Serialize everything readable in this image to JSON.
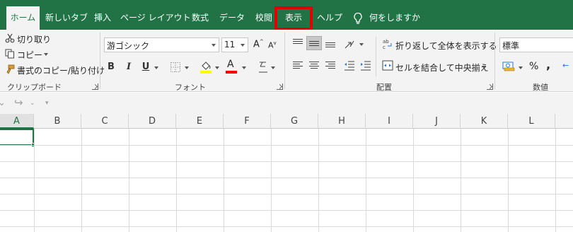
{
  "tabs": [
    {
      "label": "ホーム",
      "active": true
    },
    {
      "label": "新しいタブ"
    },
    {
      "label": "挿入"
    },
    {
      "label": "ページ レイアウト"
    },
    {
      "label": "数式"
    },
    {
      "label": "データ"
    },
    {
      "label": "校閲"
    },
    {
      "label": "表示",
      "highlighted": true
    },
    {
      "label": "ヘルプ"
    }
  ],
  "tell_me": "何をしますか",
  "clipboard": {
    "cut": "切り取り",
    "copy": "コピー",
    "format_painter": "書式のコピー/貼り付け",
    "label": "クリップボード"
  },
  "font": {
    "name": "游ゴシック",
    "size": "11",
    "grow": "A",
    "shrink": "A",
    "bold": "B",
    "italic": "I",
    "underline": "U",
    "font_color_letter": "A",
    "label": "フォント"
  },
  "alignment": {
    "wrap_text": "折り返して全体を表示する",
    "merge_center": "セルを結合して中央揃え",
    "label": "配置"
  },
  "number": {
    "format": "標準",
    "percent": "%",
    "comma": ",",
    "label": "数値"
  },
  "columns": [
    "A",
    "B",
    "C",
    "D",
    "E",
    "F",
    "G",
    "H",
    "I",
    "J",
    "K",
    "L"
  ],
  "colors": {
    "brand_green": "#217346",
    "highlight_red": "#e00000",
    "font_color_red": "#ff0000",
    "fill_yellow": "#ffff00"
  }
}
